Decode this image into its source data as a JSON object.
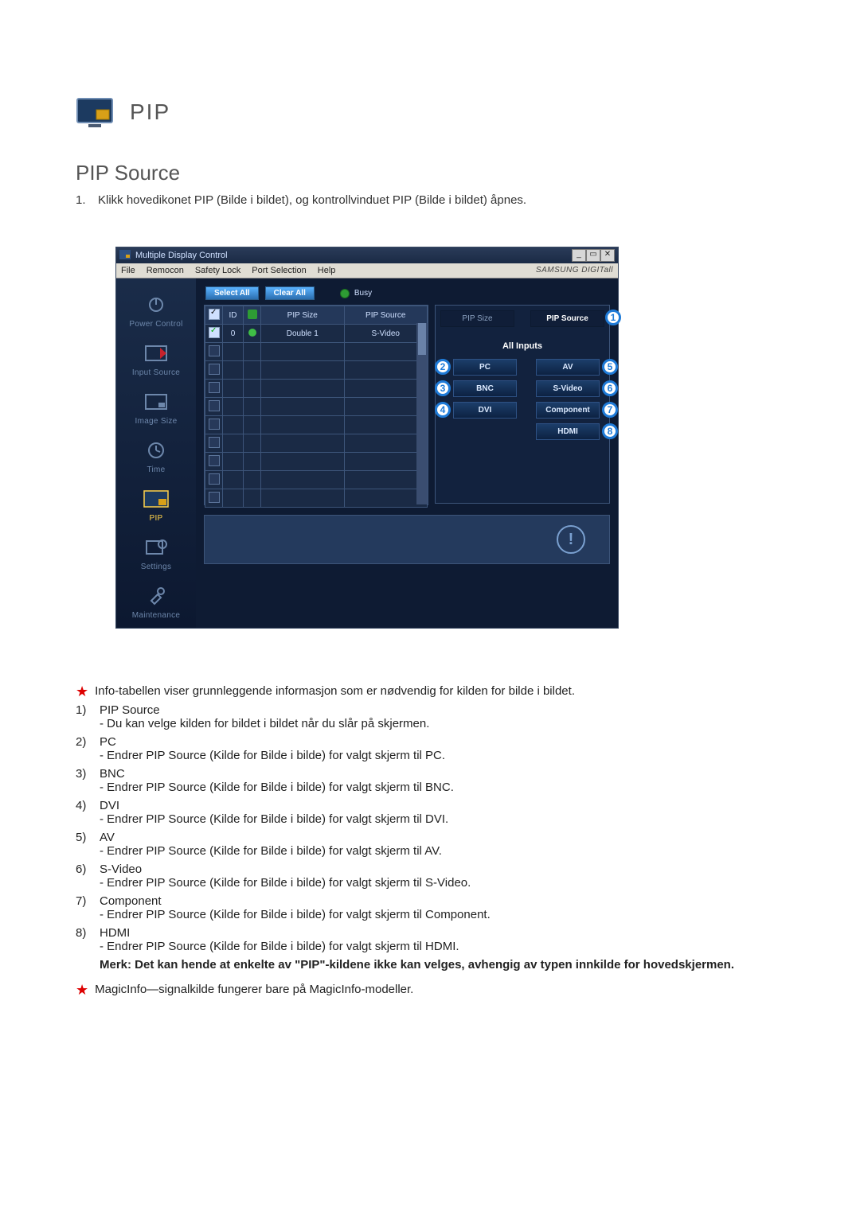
{
  "header": {
    "title": "PIP"
  },
  "subtitle": "PIP Source",
  "intro": {
    "n": "1.",
    "text": "Klikk hovedikonet PIP (Bilde i bildet), og kontrollvinduet PIP (Bilde i bildet) åpnes."
  },
  "screenshot": {
    "window_title": "Multiple Display Control",
    "brand": "SAMSUNG DIGITall",
    "menu": [
      "File",
      "Remocon",
      "Safety Lock",
      "Port Selection",
      "Help"
    ],
    "win_buttons": {
      "min": "_",
      "max": "▭",
      "close": "✕"
    },
    "sidebar": [
      {
        "label": "Power Control"
      },
      {
        "label": "Input Source"
      },
      {
        "label": "Image Size"
      },
      {
        "label": "Time"
      },
      {
        "label": "PIP"
      },
      {
        "label": "Settings"
      },
      {
        "label": "Maintenance"
      }
    ],
    "toolbar": {
      "select_all": "Select All",
      "clear_all": "Clear All",
      "busy": "Busy"
    },
    "grid": {
      "headers": [
        "✔",
        "ID",
        "",
        "PIP Size",
        "PIP Source"
      ],
      "row": {
        "id": "0",
        "size": "Double 1",
        "source": "S-Video"
      }
    },
    "panel": {
      "tab_left": "PIP Size",
      "tab_right": "PIP Source",
      "all_inputs": "All Inputs",
      "buttons": {
        "pc": "PC",
        "av": "AV",
        "bnc": "BNC",
        "svideo": "S-Video",
        "dvi": "DVI",
        "component": "Component",
        "hdmi": "HDMI"
      }
    }
  },
  "info_line_1": "Info-tabellen viser grunnleggende informasjon som er nødvendig for kilden for bilde i bildet.",
  "items": [
    {
      "n": "1)",
      "title": "PIP Source",
      "desc": "- Du kan velge kilden for bildet i bildet når du slår på skjermen."
    },
    {
      "n": "2)",
      "title": "PC",
      "desc": "- Endrer PIP Source (Kilde for Bilde i bilde) for valgt skjerm til PC."
    },
    {
      "n": "3)",
      "title": "BNC",
      "desc": "- Endrer PIP Source (Kilde for Bilde i bilde) for valgt skjerm til BNC."
    },
    {
      "n": "4)",
      "title": "DVI",
      "desc": "- Endrer PIP Source (Kilde for Bilde i bilde) for valgt skjerm til DVI."
    },
    {
      "n": "5)",
      "title": "AV",
      "desc": "- Endrer PIP Source (Kilde for Bilde i bilde) for valgt skjerm til AV."
    },
    {
      "n": "6)",
      "title": "S-Video",
      "desc": "- Endrer PIP Source (Kilde for Bilde i bilde) for valgt skjerm til S-Video."
    },
    {
      "n": "7)",
      "title": "Component",
      "desc": "- Endrer PIP Source (Kilde for Bilde i bilde) for valgt skjerm til Component."
    },
    {
      "n": "8)",
      "title": "HDMI",
      "desc": "- Endrer PIP Source (Kilde for Bilde i bilde) for valgt skjerm til HDMI."
    }
  ],
  "note": "Merk: Det kan hende at enkelte av \"PIP\"-kildene ikke kan velges, avhengig av typen innkilde for hovedskjermen.",
  "info_line_2": "MagicInfo—signalkilde fungerer bare på MagicInfo-modeller."
}
